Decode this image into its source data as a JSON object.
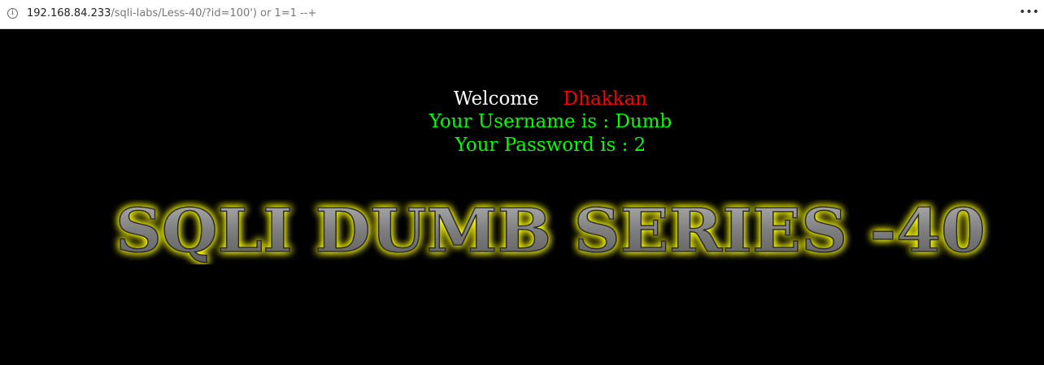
{
  "browser": {
    "url_host": "192.168.84.233",
    "url_path": "/sqli-labs/Less-40/?id=100') or 1=1 --+",
    "info_icon": "info-icon",
    "menu_icon": "more-options-icon"
  },
  "page": {
    "welcome_word": "Welcome",
    "welcome_name": "Dhakkan",
    "username_line": "Your Username is : Dumb",
    "password_line": "Your Password is : 2",
    "title_image_text": "SQLI DUMB SERIES -40"
  },
  "colors": {
    "background": "#000000",
    "welcome": "#ffffff",
    "name": "#ff0000",
    "credentials": "#00ff00",
    "title_glow": "#ffff00",
    "title_fill": "#8a8a8a"
  }
}
